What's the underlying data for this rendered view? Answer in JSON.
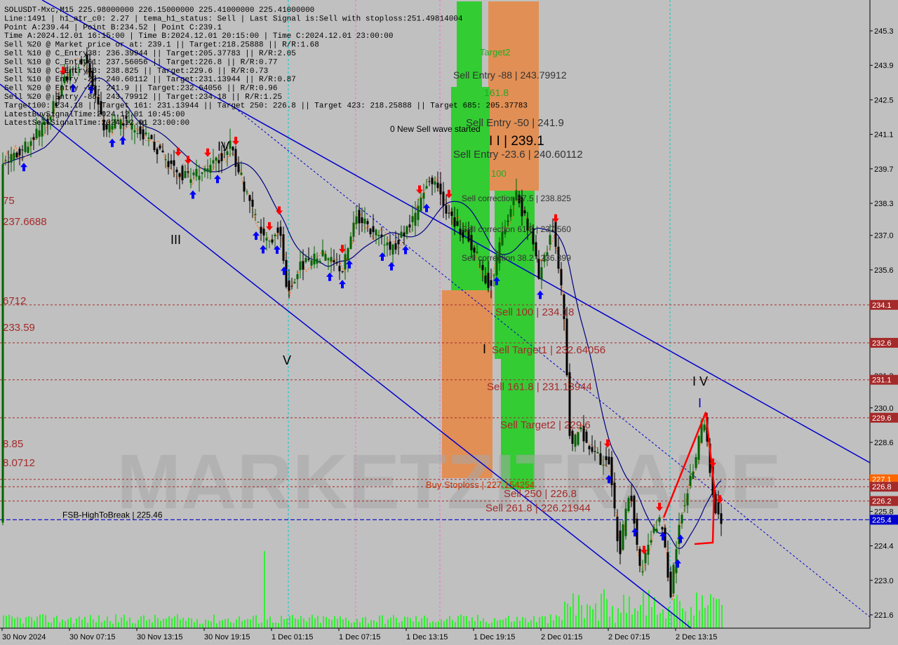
{
  "info_lines": [
    "SOLUSDT-Mxc,M15  225.98000000 226.15000000 225.41000000 225.41000000",
    "Line:1491 | h1_atr_c0: 2.27 | tema_h1_status: Sell | Last Signal is:Sell with stoploss:251.49814004",
    "Point A:239.44 | Point B:234.52 | Point C:239.1",
    "Time A:2024.12.01 16:15:00 | Time B:2024.12.01 20:15:00 | Time C:2024.12.01 23:00:00",
    "Sell %20 @ Market price or at: 239.1 || Target:218.25888 || R/R:1.68",
    "Sell %10 @ C_Entry38: 236.39944 || Target:205.37783 || R/R:2.05",
    "Sell %10 @ C_Entry61: 237.56056 || Target:226.8 || R/R:0.77",
    "Sell %10 @ C_Entry88: 238.825 || Target:229.6 || R/R:0.73",
    "Sell %10 @ Entry -23: 240.60112 || Target:231.13944 || R/R:0.87",
    "Sell %20 @ Entry -50: 241.9 || Target:232.64056 || R/R:0.96",
    "Sell %20 @ Entry -88: 243.79912 || Target:234.18 || R/R:1.25",
    "Target100: 234.18 || Target 161: 231.13944 || Target 250: 226.8 || Target 423: 218.25888 || Target 685: 205.37783",
    "LatestBuySignalTime:2024.12.01 10:45:00",
    "LatestSellSignalTime:2024.12.01 23:00:00"
  ],
  "chart_data": {
    "type": "candlestick",
    "symbol": "SOLUSDT-Mxc",
    "timeframe": "M15",
    "ylim": [
      221.0,
      246.0
    ],
    "y_ticks": [
      "245.3",
      "243.9",
      "242.5",
      "241.1",
      "239.7",
      "238.3",
      "237.0",
      "235.6",
      "234.2",
      "232.7",
      "231.3",
      "230.0",
      "228.6",
      "227.1",
      "225.8",
      "224.4",
      "223.0",
      "221.6"
    ],
    "x_labels": [
      "30 Nov 2024",
      "30 Nov 07:15",
      "30 Nov 13:15",
      "30 Nov 19:15",
      "1 Dec 01:15",
      "1 Dec 07:15",
      "1 Dec 13:15",
      "1 Dec 19:15",
      "2 Dec 01:15",
      "2 Dec 07:15",
      "2 Dec 13:15"
    ],
    "price_level_lines": [
      {
        "price": 234.18,
        "label": "Sell 100 | 234.18",
        "tag": "234.1"
      },
      {
        "price": 232.64,
        "label": "Sell Target1 | 232.64056",
        "tag": "232.6"
      },
      {
        "price": 231.14,
        "label": "Sell 161.8 | 231.13944",
        "tag": "231.1"
      },
      {
        "price": 229.6,
        "label": "Sell Target2 | 229.6",
        "tag": "229.6"
      },
      {
        "price": 227.1,
        "label": "",
        "tag": "227.1"
      },
      {
        "price": 226.8,
        "label": "Sell 250 | 226.8",
        "tag": "226.8"
      },
      {
        "price": 226.22,
        "label": "Sell 261.8 | 226.21944",
        "tag": "226.2"
      },
      {
        "price": 225.46,
        "label": "FSB-HighToBreak | 225.46",
        "tag": "225.4"
      }
    ],
    "chart_text_labels": [
      {
        "text": "Target2",
        "color": "#22aa22"
      },
      {
        "text": "Sell Entry -88 | 243.79912",
        "color": "#333333"
      },
      {
        "text": "161.8",
        "color": "#22aa22"
      },
      {
        "text": "Sell Entry -50 | 241.9",
        "color": "#333333"
      },
      {
        "text": "0 New Sell wave started",
        "color": "#000000"
      },
      {
        "text": "I I | 239.1",
        "color": "#000000"
      },
      {
        "text": "Sell Entry -23.6 | 240.60112",
        "color": "#333333"
      },
      {
        "text": "100",
        "color": "#22aa22"
      },
      {
        "text": "Sell correction 87.5 | 238.825",
        "color": "#333333"
      },
      {
        "text": "Sell correction 61.8 | 237.560",
        "color": "#333333"
      },
      {
        "text": "Sell correction 38.2 | 236.399",
        "color": "#333333"
      },
      {
        "text": "Buy Stoploss | 227.154254",
        "color": "#cc3300"
      },
      {
        "text": "III",
        "color": "#000000"
      },
      {
        "text": "IV",
        "color": "#000000"
      },
      {
        "text": "V",
        "color": "#000000"
      },
      {
        "text": "I",
        "color": "#000000"
      },
      {
        "text": "I V",
        "color": "#000000"
      },
      {
        "text": "I",
        "color": "#0000cc"
      },
      {
        "text": "237.6688",
        "color": "#a52a2a"
      },
      {
        "text": "75",
        "color": "#a52a2a"
      },
      {
        "text": "6712",
        "color": "#a52a2a"
      },
      {
        "text": "233.59",
        "color": "#a52a2a"
      },
      {
        "text": "8.85",
        "color": "#a52a2a"
      },
      {
        "text": "8.0712",
        "color": "#a52a2a"
      }
    ],
    "watermark": "MARKETZITRADE",
    "colors": {
      "sell_level": "#a52a2a",
      "buy_arrow": "#0000ff",
      "sell_arrow": "#ff0000",
      "channel": "#0000cc",
      "ma_slow": "#000000",
      "ma_fast": "#000080",
      "zone_green": "#33cc33",
      "zone_orange": "#e8823a",
      "bg": "#c0c0c0",
      "bull_candle": "#006400"
    }
  }
}
